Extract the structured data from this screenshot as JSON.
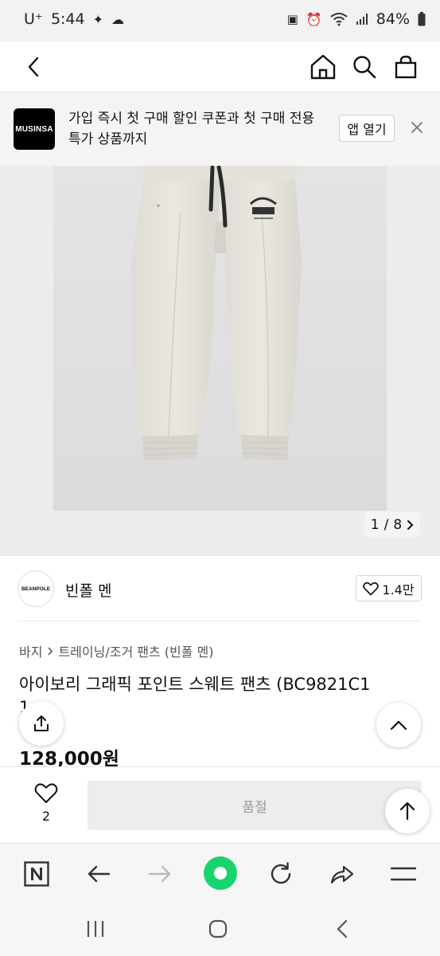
{
  "status_bar": {
    "carrier": "U⁺",
    "time": "5:44",
    "battery": "84%"
  },
  "banner": {
    "logo_text": "MUSINSA",
    "message": "가입 즉시 첫 구매 할인 쿠폰과 첫 구매 전용 특가 상품까지",
    "open_app": "앱 열기"
  },
  "gallery": {
    "current": "1",
    "separator": "/",
    "total": "8"
  },
  "brand": {
    "logo_text": "BEANPOLE",
    "name": "빈폴 멘",
    "likes": "1.4만"
  },
  "breadcrumb": {
    "root": "바지",
    "category": "트레이닝/조거 팬츠 (빈폴 멘)"
  },
  "product": {
    "title": "아이보리 그래픽 포인트 스웨트 팬츠 (BC9821C1",
    "title_overflow": "1",
    "price": "128,000원"
  },
  "buy_bar": {
    "wish_count": "2",
    "sold_out_label": "품절"
  }
}
